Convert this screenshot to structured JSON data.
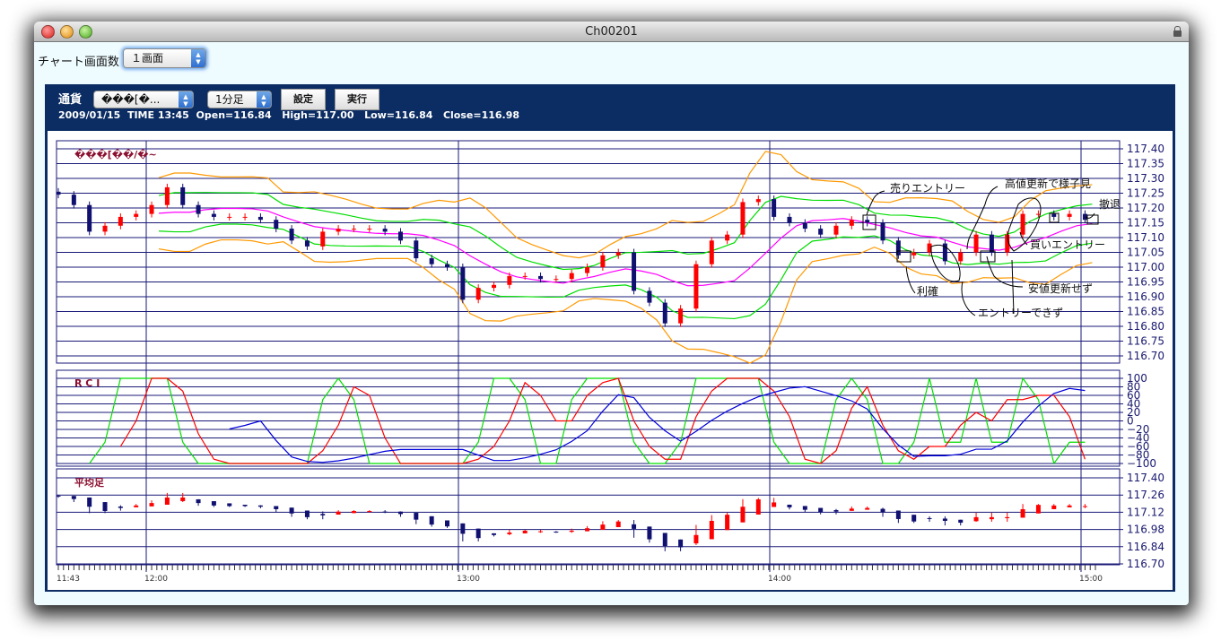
{
  "window": {
    "title": "Ch00201"
  },
  "toolbar": {
    "screen_count_label": "チャート画面数",
    "screen_count_value": "１画面"
  },
  "header": {
    "currency_label": "通貨",
    "currency_value": "���[�...",
    "timeframe_value": "1分足",
    "settings_button": "設定",
    "run_button": "実行",
    "info": {
      "date": "2009/01/15",
      "time": "TIME 13:45",
      "open": "Open=116.84",
      "high": "High=117.00",
      "low": "Low=116.84",
      "close": "Close=116.98"
    }
  },
  "chart_data": {
    "type": "candlestick",
    "title": "���[��/�~",
    "interval_minutes": 3,
    "start_time": "11:43",
    "close": [
      117.245,
      117.21,
      117.12,
      117.14,
      117.17,
      117.18,
      117.21,
      117.27,
      117.21,
      117.18,
      117.17,
      117.17,
      117.17,
      117.16,
      117.13,
      117.09,
      117.07,
      117.12,
      117.13,
      117.13,
      117.13,
      117.12,
      117.09,
      117.03,
      117.01,
      117.0,
      116.89,
      116.93,
      116.94,
      116.97,
      116.97,
      116.96,
      116.96,
      116.98,
      117.0,
      117.04,
      117.05,
      116.92,
      116.88,
      116.81,
      116.86,
      117.01,
      117.09,
      117.11,
      117.22,
      117.23,
      117.17,
      117.15,
      117.13,
      117.11,
      117.14,
      117.16,
      117.15,
      117.09,
      117.04,
      117.05,
      117.08,
      117.02,
      117.05,
      117.11,
      117.05,
      117.11,
      117.18,
      117.18,
      117.17,
      117.18,
      117.16
    ],
    "price_axis": {
      "ylim": [
        116.7,
        117.4
      ],
      "ticks": [
        "117.40",
        "117.35",
        "117.30",
        "117.25",
        "117.20",
        "117.15",
        "117.10",
        "117.05",
        "117.00",
        "116.95",
        "116.90",
        "116.85",
        "116.80",
        "116.75",
        "116.70"
      ]
    },
    "time_labels": [
      "11:43",
      "12:00",
      "13:00",
      "14:00",
      "15:00"
    ],
    "bands_colors": {
      "middle": "#ff00ff",
      "sigma1": "#00dd00",
      "sigma2": "#ff9900"
    },
    "up_color": "#ff0000",
    "down_color": "#101070",
    "rci": {
      "label": "R C I",
      "ylim": [
        -100,
        100
      ],
      "ticks": [
        "100",
        "80",
        "60",
        "40",
        "20",
        "0",
        "−20",
        "−40",
        "−60",
        "−80",
        "−100"
      ],
      "colors": [
        "#00dd00",
        "#ff0000",
        "#0000dd"
      ]
    },
    "heikin_ashi": {
      "label": "平均足",
      "ylim": [
        116.7,
        117.4
      ],
      "ticks": [
        "117.40",
        "117.26",
        "117.12",
        "116.98",
        "116.84",
        "116.70"
      ]
    }
  },
  "annotations": {
    "sell_entry": "売りエントリー",
    "high_update_wait": "高値更新で様子見",
    "retreat": "撤退",
    "buy_entry": "買いエントリー",
    "no_new_low": "安値更新せず",
    "take_profit": "利確",
    "no_entry": "エントリーできず"
  }
}
